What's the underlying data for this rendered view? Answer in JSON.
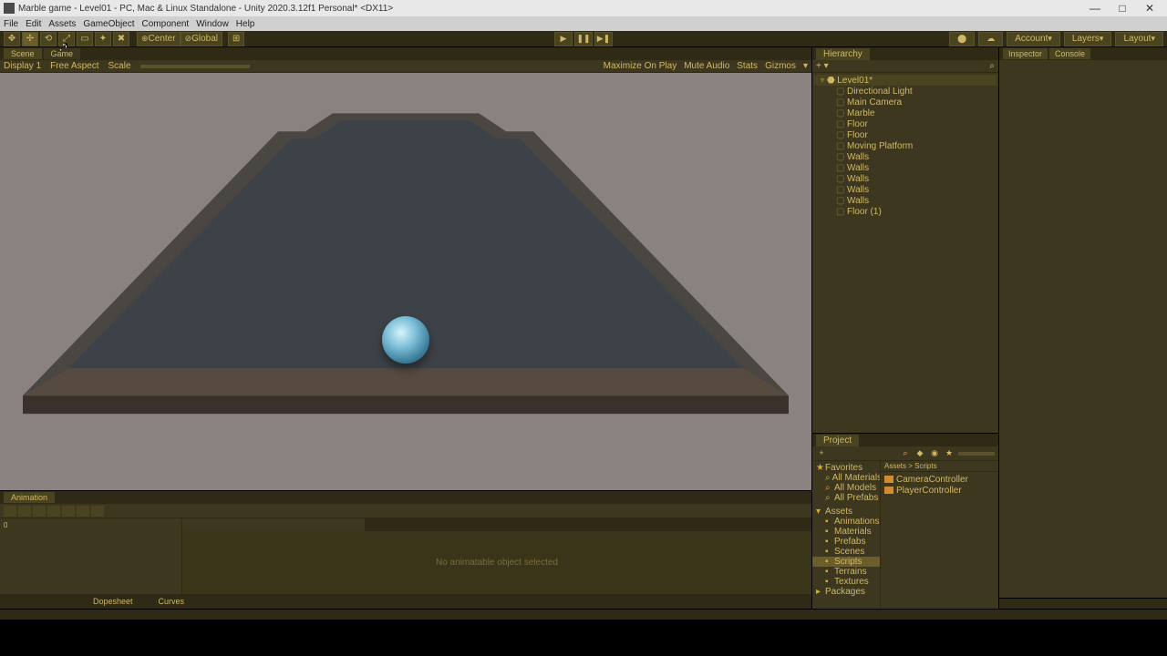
{
  "titlebar": {
    "title": "Marble game - Level01 - PC, Mac & Linux Standalone - Unity 2020.3.12f1 Personal* <DX11>"
  },
  "menubar": [
    "File",
    "Edit",
    "Assets",
    "GameObject",
    "Component",
    "Window",
    "Help"
  ],
  "toolbar": {
    "pivot": "Center",
    "handle": "Global",
    "right": {
      "account": "Account",
      "layers": "Layers",
      "layout": "Layout"
    }
  },
  "tabs": {
    "scene": "Scene",
    "game": "Game"
  },
  "viewbar": {
    "display": "Display 1",
    "aspect": "Free Aspect",
    "scale": "Scale",
    "maximize": "Maximize On Play",
    "mute": "Mute Audio",
    "stats": "Stats",
    "gizmos": "Gizmos"
  },
  "hierarchy": {
    "title": "Hierarchy",
    "scene": "Level01*",
    "items": [
      "Directional Light",
      "Main Camera",
      "Marble",
      "Floor",
      "Floor",
      "Moving Platform",
      "Walls",
      "Walls",
      "Walls",
      "Walls",
      "Walls",
      "Floor (1)"
    ]
  },
  "project": {
    "title": "Project",
    "favorites": "Favorites",
    "fav_items": [
      "All Materials",
      "All Models",
      "All Prefabs"
    ],
    "assets": "Assets",
    "folders": [
      "Animations",
      "Materials",
      "Prefabs",
      "Scenes",
      "Scripts",
      "Terrains",
      "Textures"
    ],
    "packages": "Packages",
    "breadcrumb": "Assets > Scripts",
    "files": [
      "CameraController",
      "PlayerController"
    ]
  },
  "inspector": {
    "title": "Inspector",
    "console": "Console"
  },
  "animation": {
    "title": "Animation",
    "empty": "No animatable object selected",
    "dopesheet": "Dopesheet",
    "curves": "Curves"
  }
}
